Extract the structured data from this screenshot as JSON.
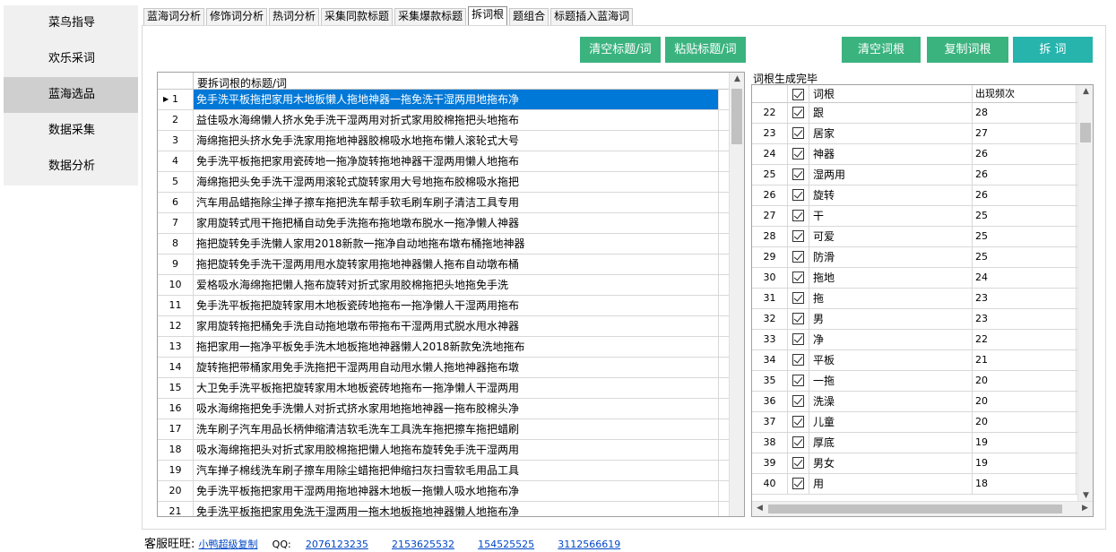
{
  "nav": [
    {
      "label": "菜鸟指导",
      "active": false
    },
    {
      "label": "欢乐采词",
      "active": false
    },
    {
      "label": "蓝海选品",
      "active": true
    },
    {
      "label": "数据采集",
      "active": false
    },
    {
      "label": "数据分析",
      "active": false
    }
  ],
  "tabs": [
    "蓝海词分析",
    "修饰词分析",
    "热词分析",
    "采集同款标题",
    "采集爆款标题",
    "拆词根",
    "题组合",
    "标题插入蓝海词"
  ],
  "active_tab": 5,
  "buttons": {
    "clear_titles": "清空标题/词",
    "paste_titles": "粘贴标题/词",
    "clear_roots": "清空词根",
    "copy_roots": "复制词根",
    "split": "拆  词"
  },
  "left_grid": {
    "header": "要拆词根的标题/词",
    "selected_row": 1,
    "rows": [
      {
        "n": "1",
        "title": "免手洗平板拖把家用木地板懒人拖地神器一拖免洗干湿两用地拖布净"
      },
      {
        "n": "2",
        "title": "益佳吸水海绵懒人挤水免手洗干湿两用对折式家用胶棉拖把头地拖布"
      },
      {
        "n": "3",
        "title": "海绵拖把头挤水免手洗家用拖地神器胶棉吸水地拖布懒人滚轮式大号"
      },
      {
        "n": "4",
        "title": "免手洗平板拖把家用瓷砖地一拖净旋转拖地神器干湿两用懒人地拖布"
      },
      {
        "n": "5",
        "title": "海绵拖把头免手洗干湿两用滚轮式旋转家用大号地拖布胶棉吸水拖把"
      },
      {
        "n": "6",
        "title": "汽车用品蜡拖除尘掸子擦车拖把洗车帮手软毛刷车刷子清洁工具专用"
      },
      {
        "n": "7",
        "title": "家用旋转式甩干拖把桶自动免手洗拖布拖地墩布脱水一拖净懒人神器"
      },
      {
        "n": "8",
        "title": "拖把旋转免手洗懒人家用2018新款一拖净自动地拖布墩布桶拖地神器"
      },
      {
        "n": "9",
        "title": "拖把旋转免手洗干湿两用甩水旋转家用拖地神器懒人拖布自动墩布桶"
      },
      {
        "n": "10",
        "title": "爱格吸水海绵拖把懒人拖布旋转对折式家用胶棉拖把头地拖免手洗"
      },
      {
        "n": "11",
        "title": "免手洗平板拖把旋转家用木地板瓷砖地拖布一拖净懒人干湿两用拖布"
      },
      {
        "n": "12",
        "title": "家用旋转拖把桶免手洗自动拖地墩布带拖布干湿两用式脱水甩水神器"
      },
      {
        "n": "13",
        "title": "拖把家用一拖净平板免手洗木地板拖地神器懒人2018新款免洗地拖布"
      },
      {
        "n": "14",
        "title": "旋转拖把带桶家用免手洗拖把干湿两用自动甩水懒人拖地神器拖布墩"
      },
      {
        "n": "15",
        "title": "大卫免手洗平板拖把旋转家用木地板瓷砖地拖布一拖净懒人干湿两用"
      },
      {
        "n": "16",
        "title": "吸水海绵拖把免手洗懒人对折式挤水家用地拖地神器一拖布胶棉头净"
      },
      {
        "n": "17",
        "title": "洗车刷子汽车用品长柄伸缩清洁软毛洗车工具洗车拖把擦车拖把蜡刷"
      },
      {
        "n": "18",
        "title": "吸水海绵拖把头对折式家用胶棉拖把懒人地拖布旋转免手洗干湿两用"
      },
      {
        "n": "19",
        "title": "汽车掸子棉线洗车刷子擦车用除尘蜡拖把伸缩扫灰扫雪软毛用品工具"
      },
      {
        "n": "20",
        "title": "免手洗平板拖把家用干湿两用拖地神器木地板一拖懒人吸水地拖布净"
      },
      {
        "n": "21",
        "title": "免手洗平板拖把家用免洗干湿两用一拖木地板拖地神器懒人地拖布净"
      }
    ]
  },
  "right_grid": {
    "label": "词根生成完毕",
    "col_word": "词根",
    "col_freq": "出现频次",
    "rows": [
      {
        "n": "22",
        "word": "跟",
        "freq": "28"
      },
      {
        "n": "23",
        "word": "居家",
        "freq": "27"
      },
      {
        "n": "24",
        "word": "神器",
        "freq": "26"
      },
      {
        "n": "25",
        "word": "湿两用",
        "freq": "26"
      },
      {
        "n": "26",
        "word": "旋转",
        "freq": "26"
      },
      {
        "n": "27",
        "word": "干",
        "freq": "25"
      },
      {
        "n": "28",
        "word": "可爱",
        "freq": "25"
      },
      {
        "n": "29",
        "word": "防滑",
        "freq": "25"
      },
      {
        "n": "30",
        "word": "拖地",
        "freq": "24"
      },
      {
        "n": "31",
        "word": "拖",
        "freq": "23"
      },
      {
        "n": "32",
        "word": "男",
        "freq": "23"
      },
      {
        "n": "33",
        "word": "净",
        "freq": "22"
      },
      {
        "n": "34",
        "word": "平板",
        "freq": "21"
      },
      {
        "n": "35",
        "word": "一拖",
        "freq": "20"
      },
      {
        "n": "36",
        "word": "洗澡",
        "freq": "20"
      },
      {
        "n": "37",
        "word": "儿童",
        "freq": "20"
      },
      {
        "n": "38",
        "word": "厚底",
        "freq": "19"
      },
      {
        "n": "39",
        "word": "男女",
        "freq": "19"
      },
      {
        "n": "40",
        "word": "用",
        "freq": "18"
      }
    ]
  },
  "footer": {
    "service_label": "客服旺旺:",
    "service_link": "小鸭超级复制",
    "qq_label": "QQ:",
    "qq": [
      "2076123235",
      "2153625532",
      "154525525",
      "3112566619"
    ]
  }
}
